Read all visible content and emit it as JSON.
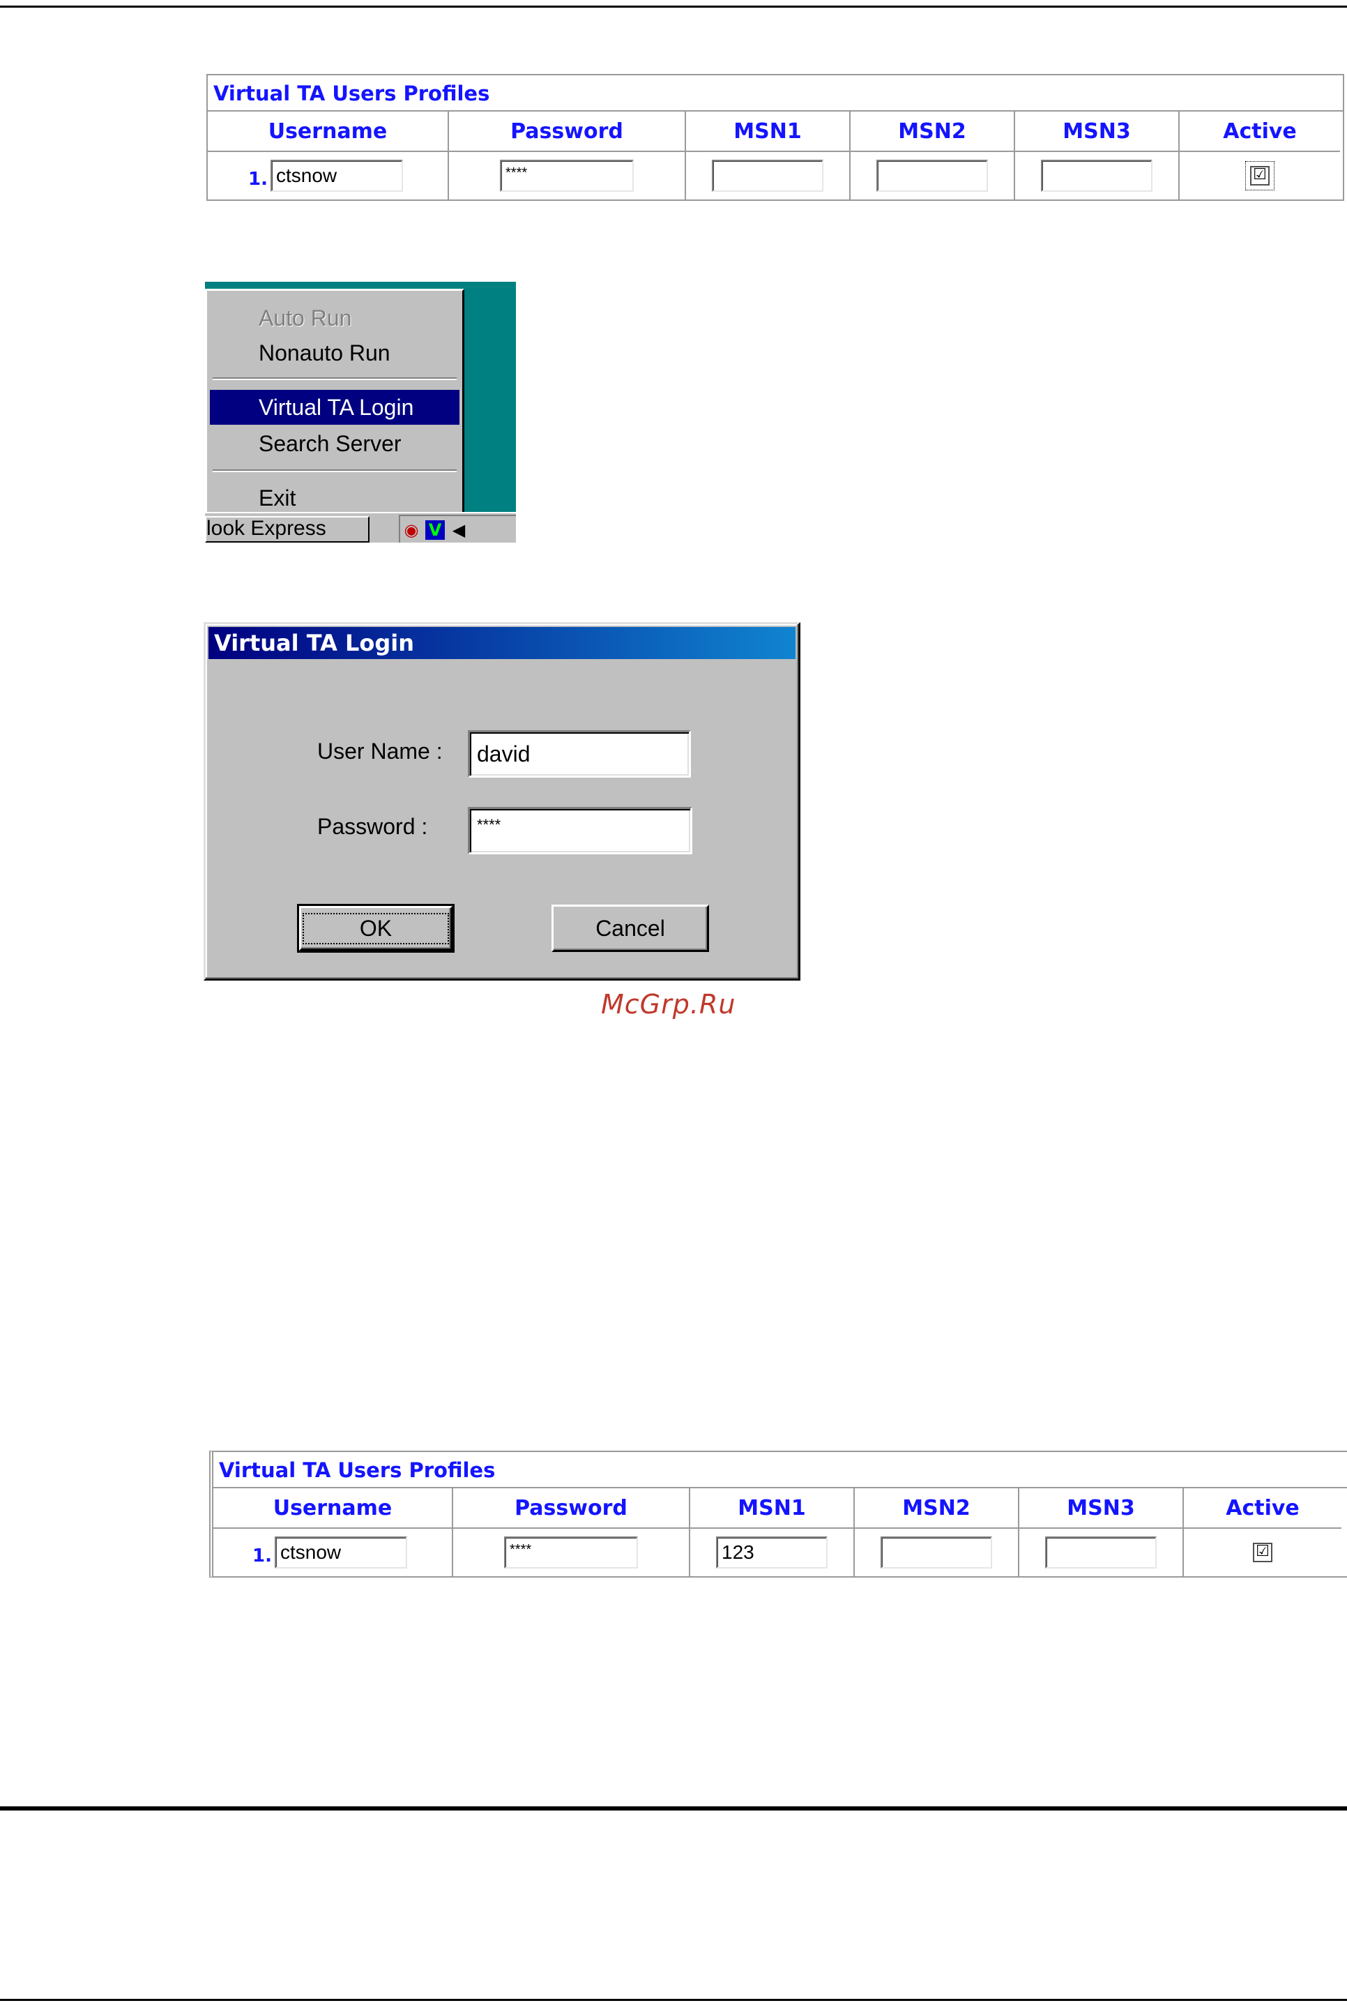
{
  "table1": {
    "title": "Virtual TA Users Profiles",
    "headers": [
      "Username",
      "Password",
      "MSN1",
      "MSN2",
      "MSN3",
      "Active"
    ],
    "row": {
      "index": "1.",
      "username": "ctsnow",
      "password": "****",
      "msn1": "",
      "msn2": "",
      "msn3": "",
      "active_mark": "☑"
    }
  },
  "context_menu": {
    "items": [
      {
        "label": "Auto Run",
        "state": "disabled"
      },
      {
        "label": "Nonauto Run",
        "state": "normal"
      },
      {
        "label": "Virtual TA Login",
        "state": "selected"
      },
      {
        "label": "Search Server",
        "state": "normal"
      },
      {
        "label": "Exit",
        "state": "normal"
      }
    ],
    "taskbar_button": "look Express"
  },
  "login_dialog": {
    "title": "Virtual TA Login",
    "username_label": "User Name :",
    "username_value": "david",
    "password_label": "Password :",
    "password_value": "****",
    "ok_label": "OK",
    "cancel_label": "Cancel"
  },
  "watermark": "McGrp.Ru",
  "table2": {
    "title": "Virtual TA Users Profiles",
    "headers": [
      "Username",
      "Password",
      "MSN1",
      "MSN2",
      "MSN3",
      "Active"
    ],
    "row": {
      "index": "1.",
      "username": "ctsnow",
      "password": "****",
      "msn1": "123",
      "msn2": "",
      "msn3": "",
      "active_mark": "☑"
    }
  },
  "colors": {
    "header_text": "#1414ff",
    "menu_highlight": "#000080",
    "desktop": "#008080"
  }
}
